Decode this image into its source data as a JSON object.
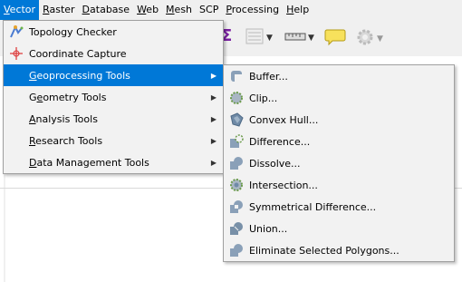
{
  "menubar": {
    "items": [
      {
        "accel": "V",
        "rest": "ector"
      },
      {
        "accel": "R",
        "rest": "aster"
      },
      {
        "accel": "D",
        "rest": "atabase"
      },
      {
        "accel": "W",
        "rest": "eb"
      },
      {
        "accel": "M",
        "rest": "esh"
      },
      {
        "accel": "",
        "rest": "SCP"
      },
      {
        "accel": "P",
        "rest": "rocessing"
      },
      {
        "accel": "H",
        "rest": "elp"
      }
    ]
  },
  "vector_menu": {
    "items": [
      {
        "label": "Topology Checker",
        "icon": "topology-checker-icon"
      },
      {
        "label": "Coordinate Capture",
        "icon": "crosshair-icon"
      },
      {
        "accel": "G",
        "rest": "eoprocessing Tools",
        "icon": "none"
      },
      {
        "accel": "",
        "label_before": "G",
        "accel2": "e",
        "rest": "ometry Tools"
      },
      {
        "accel": "A",
        "rest": "nalysis Tools"
      },
      {
        "accel": "R",
        "rest": "esearch Tools"
      },
      {
        "accel": "D",
        "rest": "ata Management Tools"
      }
    ]
  },
  "geoprocessing_menu": {
    "items": [
      {
        "label": "Buffer...",
        "icon": "buffer-icon"
      },
      {
        "label": "Clip...",
        "icon": "clip-icon"
      },
      {
        "label": "Convex Hull...",
        "icon": "convex-hull-icon"
      },
      {
        "label": "Difference...",
        "icon": "difference-icon"
      },
      {
        "label": "Dissolve...",
        "icon": "dissolve-icon"
      },
      {
        "label": "Intersection...",
        "icon": "intersection-icon"
      },
      {
        "label": "Symmetrical Difference...",
        "icon": "symmetrical-difference-icon"
      },
      {
        "label": "Union...",
        "icon": "union-icon"
      },
      {
        "label": "Eliminate Selected Polygons...",
        "icon": "eliminate-polygons-icon"
      }
    ]
  },
  "colors": {
    "highlight": "#0078d7",
    "menu_bg": "#f2f2f2"
  }
}
